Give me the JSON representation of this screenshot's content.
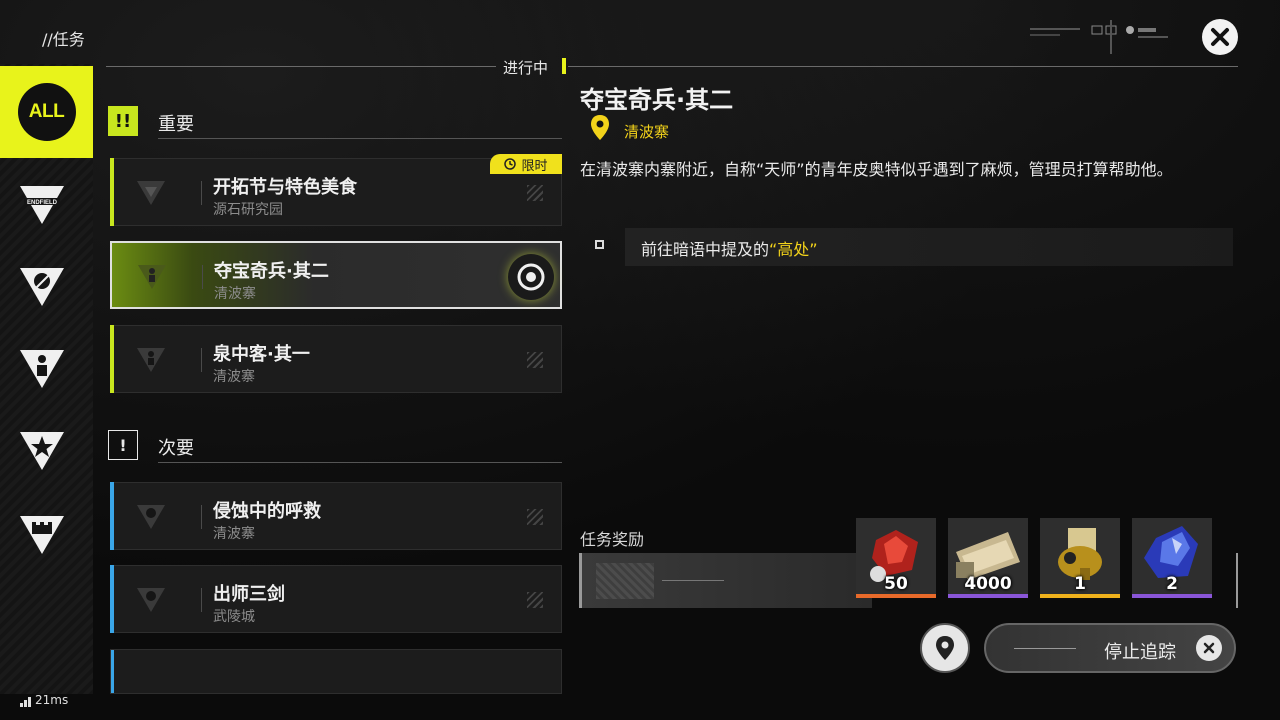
{
  "header": {
    "title": "//任务",
    "status_tag": "进行中"
  },
  "categories": [
    {
      "label": "ALL",
      "icon": "all-category-icon",
      "active": true
    },
    {
      "label": "ENDFIELD",
      "icon": "endfield-icon"
    },
    {
      "icon": "feather-icon"
    },
    {
      "icon": "person-icon"
    },
    {
      "icon": "star-icon"
    },
    {
      "icon": "castle-icon"
    }
  ],
  "sections": {
    "important": {
      "label": "重要",
      "icon_text": "!!"
    },
    "minor": {
      "label": "次要",
      "icon_text": "!"
    }
  },
  "quests": [
    {
      "title": "开拓节与特色美食",
      "location": "源石研究园",
      "badge": "限时",
      "accent": "#c8e61e"
    },
    {
      "title": "夺宝奇兵·其二",
      "location": "清波寨",
      "selected": true,
      "accent": "#c8e61e"
    },
    {
      "title": "泉中客·其一",
      "location": "清波寨",
      "accent": "#c8e61e"
    },
    {
      "title": "侵蚀中的呼救",
      "location": "清波寨",
      "accent": "#3aa6e8"
    },
    {
      "title": "出师三剑",
      "location": "武陵城",
      "accent": "#3aa6e8"
    }
  ],
  "detail": {
    "title": "夺宝奇兵·其二",
    "location": "清波寨",
    "description": "在清波寨内寨附近，自称“天师”的青年皮奥特似乎遇到了麻烦，管理员打算帮助他。",
    "objective_prefix": "前往暗语中提及的",
    "objective_highlight": "“高处”"
  },
  "rewards": {
    "label": "任务奖励",
    "items": [
      {
        "name": "red-crystal-icon",
        "qty": "50",
        "rarity_color": "#e86a2a"
      },
      {
        "name": "currency-notes-icon",
        "qty": "4000",
        "rarity_color": "#8a56d8"
      },
      {
        "name": "gold-component-icon",
        "qty": "1",
        "rarity_color": "#f0b21c"
      },
      {
        "name": "blue-crystal-icon",
        "qty": "2",
        "rarity_color": "#8a56d8"
      }
    ]
  },
  "actions": {
    "stop_tracking": "停止追踪"
  },
  "status": {
    "ping": "21ms"
  },
  "colors": {
    "accent_yellow": "#e8f31b",
    "highlight_gold": "#f2d21a"
  }
}
